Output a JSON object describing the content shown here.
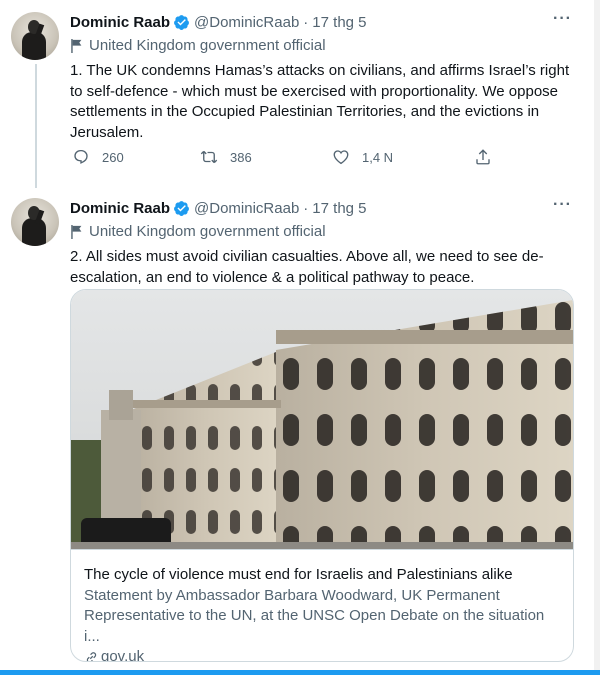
{
  "tweets": [
    {
      "author_name": "Dominic Raab",
      "handle": "@DominicRaab",
      "separator": "·",
      "date": "17 thg 5",
      "label": "United Kingdom government official",
      "text": "1. The UK condemns Hamas’s attacks on civilians, and affirms Israel’s right to self-defence - which must be exercised with proportionality. We oppose settlements in the Occupied Palestinian Territories, and the evictions in Jerusalem.",
      "replies": "260",
      "retweets": "386",
      "likes": "1,4 N"
    },
    {
      "author_name": "Dominic Raab",
      "handle": "@DominicRaab",
      "separator": "·",
      "date": "17 thg 5",
      "label": "United Kingdom government official",
      "text": "2. All sides must avoid civilian casualties. Above all, we need to see de-escalation, an end to violence & a political pathway to peace.",
      "card": {
        "title": "The cycle of violence must end for Israelis and Palestinians alike",
        "description": "Statement by Ambassador Barbara Woodward, UK Permanent Representative to the UN, at the UNSC Open Debate on the situation i...",
        "domain": "gov.uk"
      }
    }
  ],
  "more_glyph": "···",
  "colors": {
    "accent": "#1d9bf0",
    "muted": "#536471",
    "border": "#cfd9de"
  },
  "icons": [
    "verified-badge-icon",
    "flag-icon",
    "reply-icon",
    "retweet-icon",
    "like-icon",
    "share-icon",
    "link-icon",
    "more-icon"
  ]
}
